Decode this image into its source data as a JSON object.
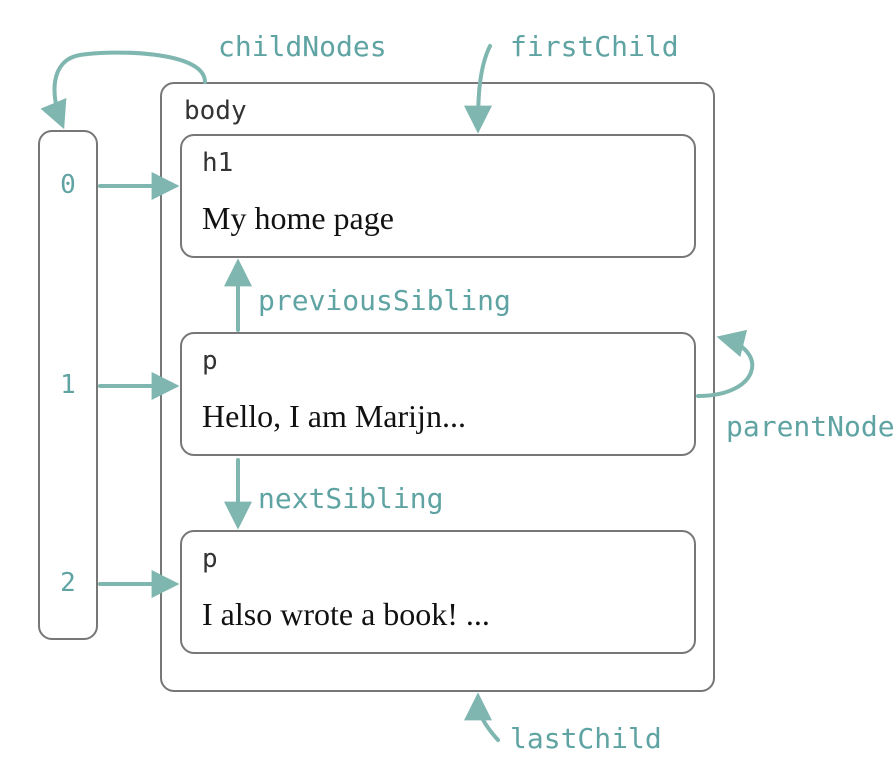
{
  "labels": {
    "childNodes": "childNodes",
    "firstChild": "firstChild",
    "previousSibling": "previousSibling",
    "nextSibling": "nextSibling",
    "parentNode": "parentNode",
    "lastChild": "lastChild"
  },
  "body": {
    "tag": "body",
    "children": [
      {
        "index": "0",
        "tag": "h1",
        "text": "My home page"
      },
      {
        "index": "1",
        "tag": "p",
        "text": "Hello, I am Marijn..."
      },
      {
        "index": "2",
        "tag": "p",
        "text": "I also wrote a book! ..."
      }
    ]
  },
  "colors": {
    "arrow": "#7fb7b0",
    "box": "#777777"
  }
}
